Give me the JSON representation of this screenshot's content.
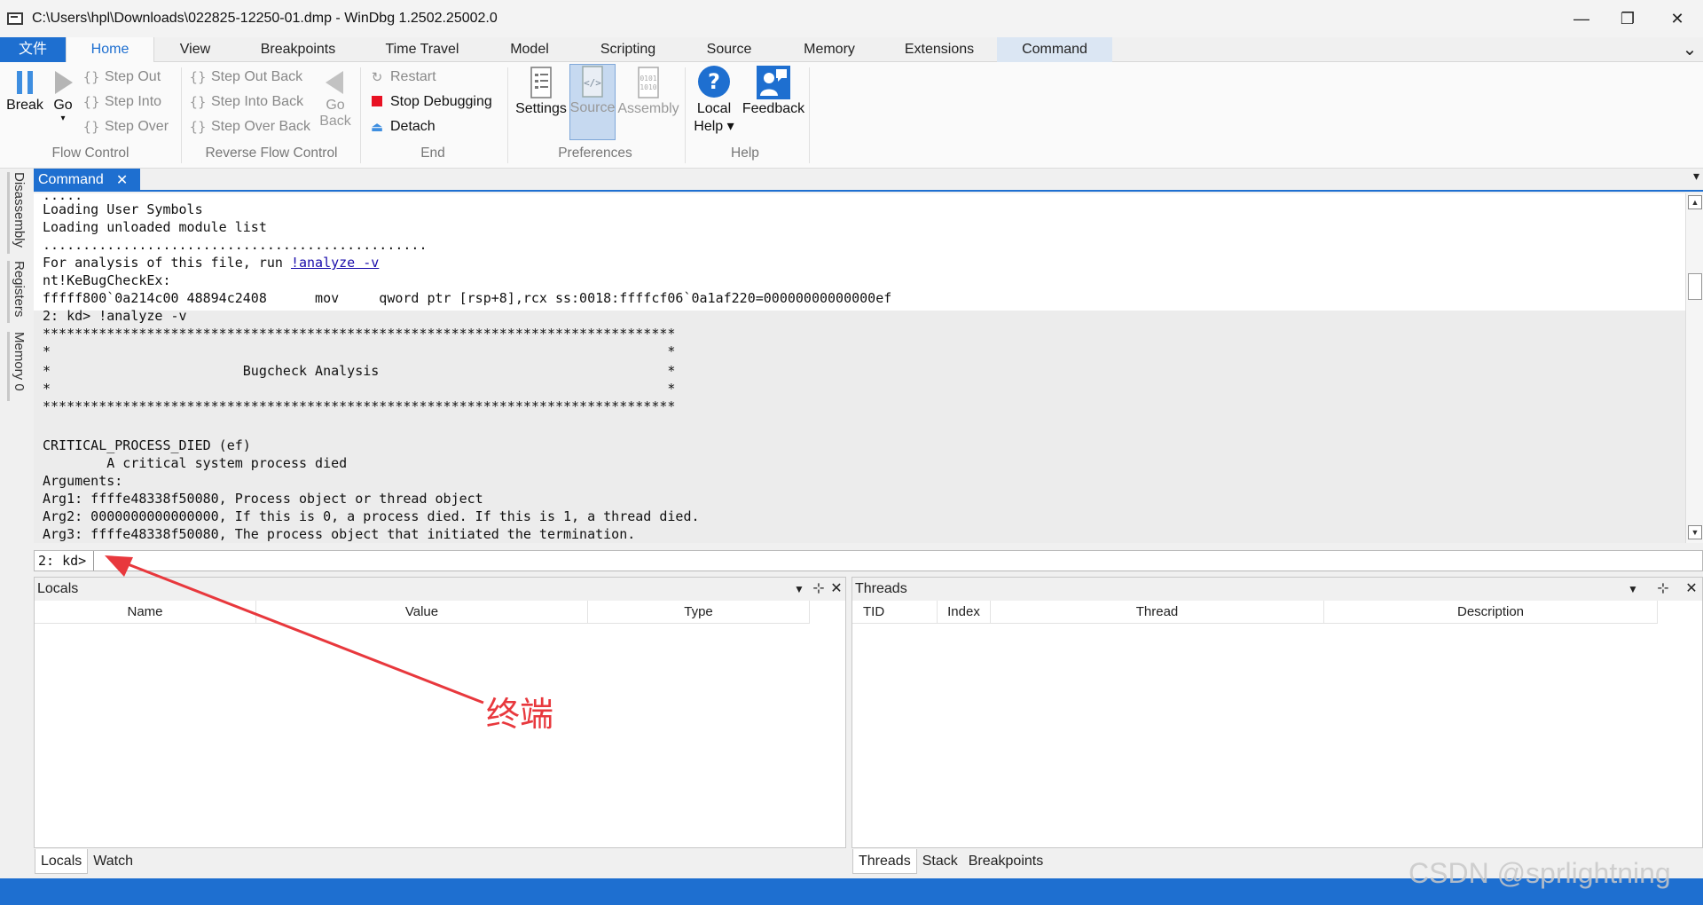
{
  "window": {
    "title": "C:\\Users\\hpl\\Downloads\\022825-12250-01.dmp - WinDbg 1.2502.25002.0",
    "minimize": "—",
    "restore": "❐",
    "close": "✕"
  },
  "ribbon_tabs": [
    "文件",
    "Home",
    "View",
    "Breakpoints",
    "Time Travel",
    "Model",
    "Scripting",
    "Source",
    "Memory",
    "Extensions",
    "Command"
  ],
  "ribbon_expand": "⌄",
  "flow_control": {
    "break": "Break",
    "go": "Go",
    "go_arrow": "▾",
    "step_out": "Step Out",
    "step_into": "Step Into",
    "step_over": "Step Over",
    "label": "Flow Control"
  },
  "reverse_flow": {
    "step_out_back": "Step Out Back",
    "step_into_back": "Step Into Back",
    "step_over_back": "Step Over Back",
    "go_back_1": "Go",
    "go_back_2": "Back",
    "label": "Reverse Flow Control"
  },
  "end": {
    "restart": "Restart",
    "stop": "Stop Debugging",
    "detach": "Detach",
    "label": "End"
  },
  "preferences": {
    "settings": "Settings",
    "source": "Source",
    "assembly": "Assembly",
    "label": "Preferences"
  },
  "help": {
    "local_help_1": "Local",
    "local_help_2": "Help ▾",
    "feedback": "Feedback",
    "label": "Help"
  },
  "side_tabs": [
    "Disassembly",
    "Registers",
    "Memory 0"
  ],
  "command_tab": {
    "label": "Command",
    "close": "✕",
    "menu": "▾"
  },
  "command_output": [
    ".....",
    "Loading User Symbols",
    "Loading unloaded module list",
    "................................................",
    "For analysis of this file, run ",
    "nt!KeBugCheckEx:",
    "fffff800`0a214c00 48894c2408      mov     qword ptr [rsp+8],rcx ss:0018:ffffcf06`0a1af220=00000000000000ef",
    "2: kd> !analyze -v",
    "*******************************************************************************",
    "*                                                                             *",
    "*                        Bugcheck Analysis                                    *",
    "*                                                                             *",
    "*******************************************************************************",
    "",
    "CRITICAL_PROCESS_DIED (ef)",
    "        A critical system process died",
    "Arguments:",
    "Arg1: ffffe48338f50080, Process object or thread object",
    "Arg2: 0000000000000000, If this is 0, a process died. If this is 1, a thread died.",
    "Arg3: ffffe48338f50080, The process object that initiated the termination."
  ],
  "analyze_link": "!analyze -v",
  "command_input": {
    "prompt": "2: kd>",
    "value": ""
  },
  "locals_panel": {
    "title": "Locals",
    "columns": [
      "Name",
      "Value",
      "Type"
    ],
    "tabs": [
      "Locals",
      "Watch"
    ]
  },
  "threads_panel": {
    "title": "Threads",
    "columns": [
      "TID",
      "Index",
      "Thread",
      "Description"
    ],
    "tabs": [
      "Threads",
      "Stack",
      "Breakpoints"
    ]
  },
  "annotation": {
    "text": "终端",
    "color": "#e8383d"
  },
  "watermark": "CSDN @sprlightning",
  "colors": {
    "accent": "#1e6fd0",
    "stop_red": "#e81123",
    "help_blue": "#1e6fd0"
  }
}
